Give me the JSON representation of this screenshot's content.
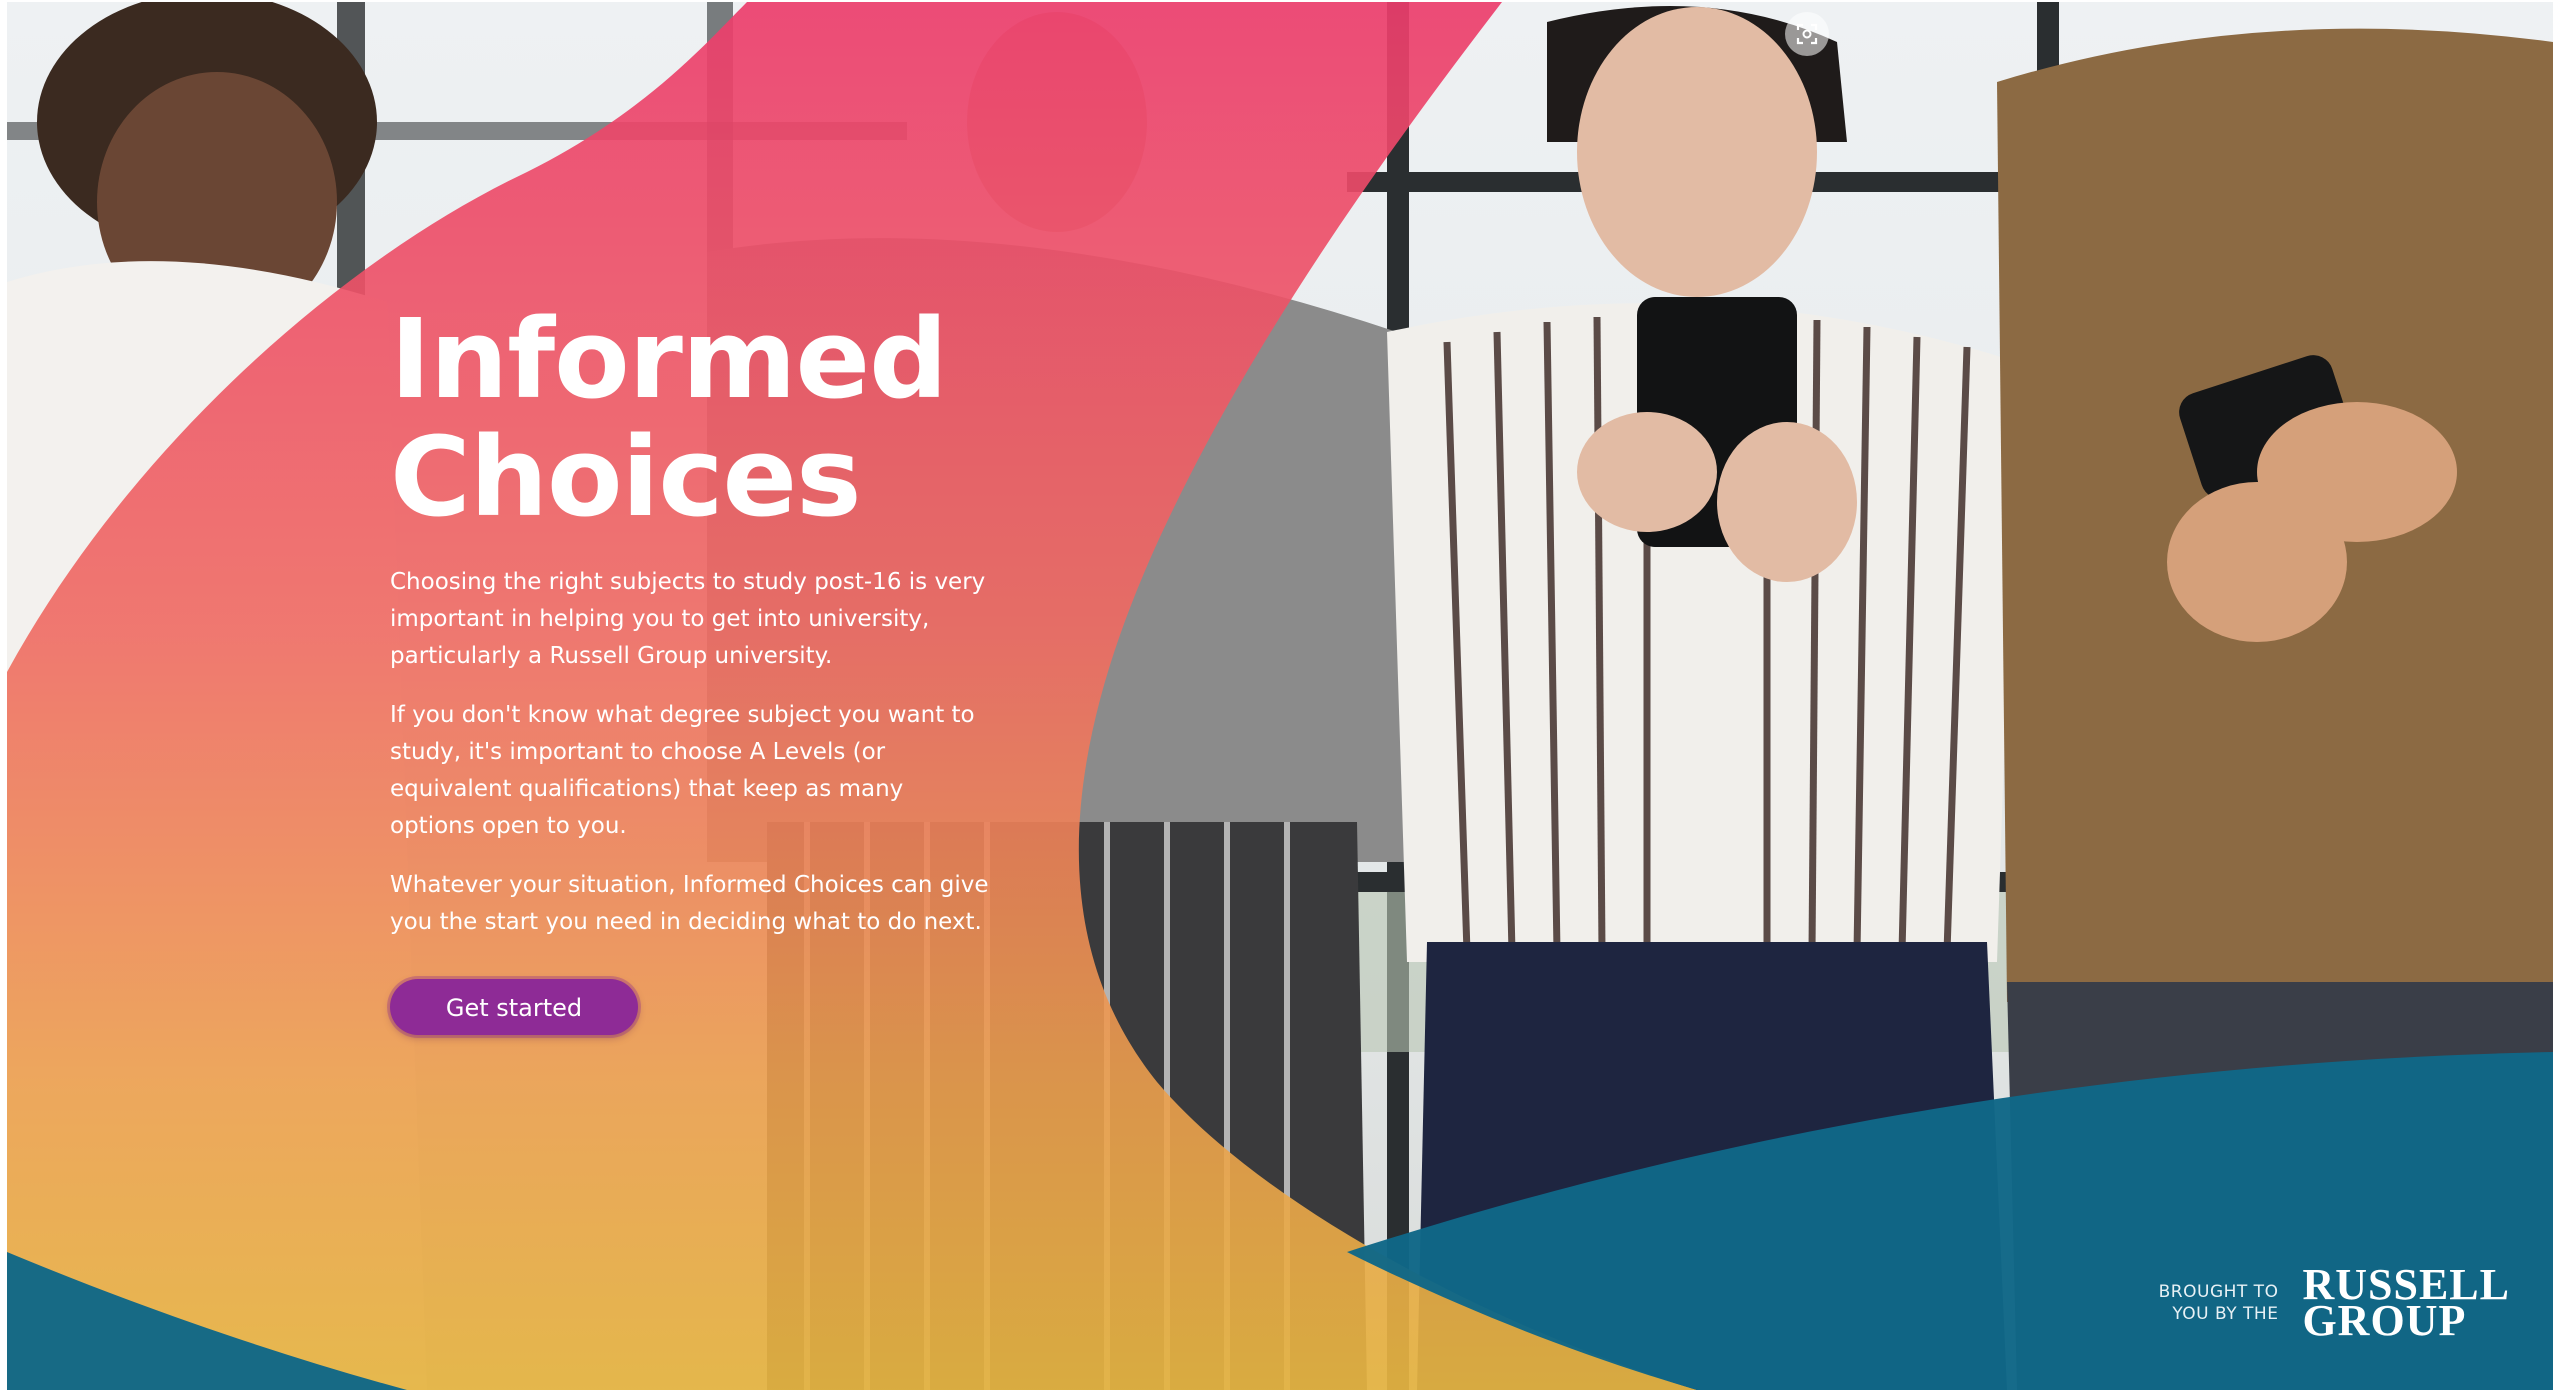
{
  "hero": {
    "title_line1": "Informed",
    "title_line2": "Choices",
    "paragraph1": "Choosing the right subjects to study post-16 is very important in helping you to get into university, particularly a Russell Group university.",
    "paragraph2": "If you don't know what degree subject you want to study, it's important to choose A Levels (or equivalent qualifications) that keep as many options open to you.",
    "paragraph3": "Whatever your situation, Informed Choices can give you the start you need in deciding what to do next.",
    "cta_label": "Get started"
  },
  "branding": {
    "brought_line1": "BROUGHT TO",
    "brought_line2": "YOU BY THE",
    "logo_line1": "RUSSELL",
    "logo_line2": "GROUP"
  },
  "icons": {
    "zoom": "screen-capture-icon"
  },
  "colors": {
    "overlay_top": "#ec3d6c",
    "overlay_bottom": "#e5b441",
    "wave_blue": "#0f6787",
    "cta_purple": "#8e2b96"
  }
}
